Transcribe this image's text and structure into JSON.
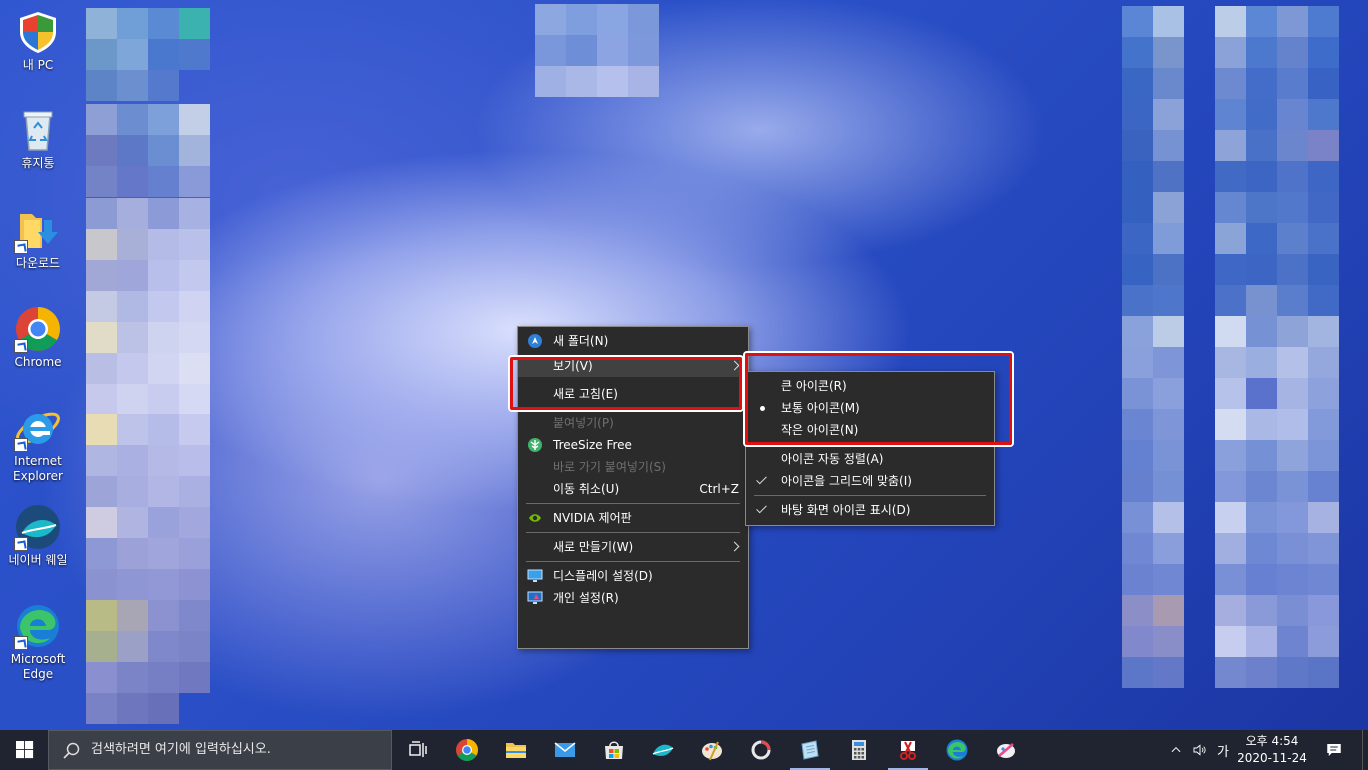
{
  "desktop_icons": [
    {
      "label": "내 PC",
      "icon": "shield-pc-icon"
    },
    {
      "label": "휴지통",
      "icon": "recycle-bin-icon"
    },
    {
      "label": "다운로드",
      "icon": "downloads-folder-icon"
    },
    {
      "label": "Chrome",
      "icon": "chrome-icon"
    },
    {
      "label": "Internet Explorer",
      "icon": "internet-explorer-icon"
    },
    {
      "label": "네이버 웨일",
      "icon": "naver-whale-icon"
    },
    {
      "label": "Microsoft Edge",
      "icon": "edge-icon"
    }
  ],
  "context_menu": {
    "new_folder": "새 폴더(N)",
    "view": "보기(V)",
    "refresh": "새로 고침(E)",
    "paste": "붙여넣기(P)",
    "treesize": "TreeSize Free",
    "paste_shortcut": "바로 가기 붙여넣기(S)",
    "undo_move": "이동 취소(U)",
    "undo_shortcut": "Ctrl+Z",
    "nvidia": "NVIDIA 제어판",
    "new": "새로 만들기(W)",
    "display_settings": "디스플레이 설정(D)",
    "personalize": "개인 설정(R)"
  },
  "view_submenu": {
    "large_icons": "큰 아이콘(R)",
    "medium_icons": "보통 아이콘(M)",
    "small_icons": "작은 아이콘(N)",
    "auto_arrange": "아이콘 자동 정렬(A)",
    "align_grid": "아이콘을 그리드에 맞춤(I)",
    "show_icons": "바탕 화면 아이콘 표시(D)"
  },
  "taskbar": {
    "search_placeholder": "검색하려면 여기에 입력하십시오.",
    "ime": "가",
    "time": "오후 4:54",
    "date": "2020-11-24"
  },
  "colors": {
    "highlight_box": "#e01010",
    "menu_bg": "#2b2b2b",
    "taskbar_bg": "#1f2430"
  }
}
